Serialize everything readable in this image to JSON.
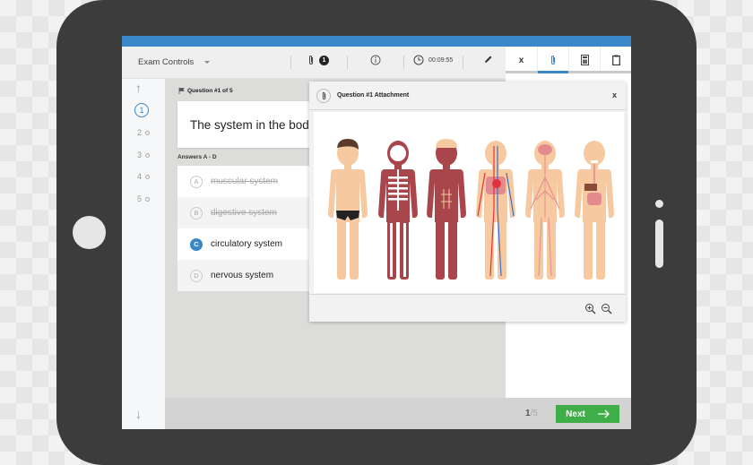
{
  "toolbar": {
    "exam_controls_label": "Exam Controls",
    "attachment_count": "1",
    "timer": "00:09:55"
  },
  "side_tabs": [
    {
      "name": "close",
      "label": "x"
    },
    {
      "name": "attachment",
      "label": "",
      "active": true
    },
    {
      "name": "calculator",
      "label": ""
    },
    {
      "name": "notepad",
      "label": ""
    }
  ],
  "nav": {
    "questions": [
      {
        "label": "1",
        "current": true
      },
      {
        "label": "2"
      },
      {
        "label": "3"
      },
      {
        "label": "4"
      },
      {
        "label": "5"
      }
    ]
  },
  "question": {
    "header": "Question #1 of 5",
    "text": "The system in the body",
    "answers_label": "Answers A - D",
    "answers": [
      {
        "letter": "A",
        "text": "muscular system",
        "state": "struck"
      },
      {
        "letter": "B",
        "text": "digestive system",
        "state": "struck"
      },
      {
        "letter": "C",
        "text": "circulatory system",
        "state": "selected"
      },
      {
        "letter": "D",
        "text": "nervous system",
        "state": "normal"
      }
    ]
  },
  "attachment_modal": {
    "title": "Question #1 Attachment",
    "close_label": "x",
    "figures": [
      "body",
      "skeletal system",
      "muscular system",
      "circulatory system",
      "nervous system",
      "digestive system"
    ]
  },
  "footer": {
    "current_page": "1",
    "total_pages": "/5",
    "next_label": "Next"
  },
  "colors": {
    "accent": "#3b88c8",
    "next_button": "#3fae49",
    "tablet_frame": "#3c3c3c"
  }
}
